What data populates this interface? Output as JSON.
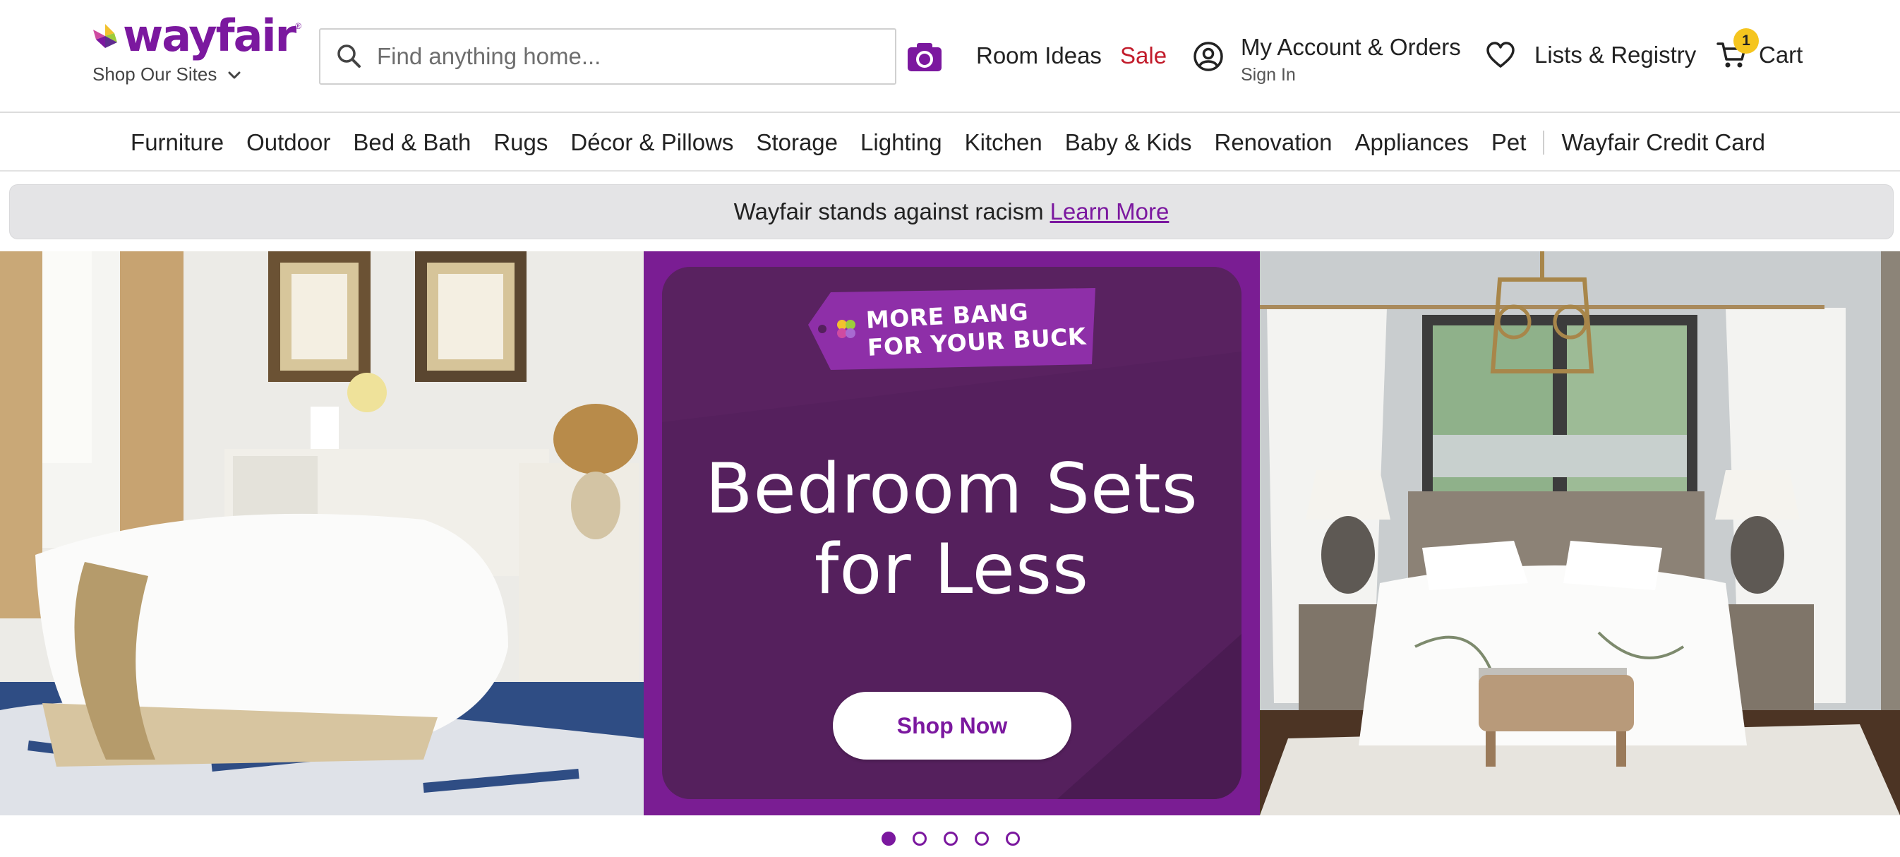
{
  "header": {
    "logo_text": "wayfair",
    "shop_sites_label": "Shop Our Sites",
    "search_placeholder": "Find anything home...",
    "room_ideas": "Room Ideas",
    "sale": "Sale",
    "account_label": "My Account & Orders",
    "sign_in": "Sign In",
    "lists_label": "Lists & Registry",
    "cart_label": "Cart",
    "cart_count": "1",
    "brand_color": "#7b189f",
    "sale_color": "#c21c2b",
    "badge_color": "#f5c51f"
  },
  "categories": [
    "Furniture",
    "Outdoor",
    "Bed & Bath",
    "Rugs",
    "Décor & Pillows",
    "Storage",
    "Lighting",
    "Kitchen",
    "Baby & Kids",
    "Renovation",
    "Appliances",
    "Pet"
  ],
  "credit_card_link": "Wayfair Credit Card",
  "notice": {
    "text": "Wayfair stands against racism",
    "link": "Learn More"
  },
  "hero": {
    "tag_line1": "MORE BANG",
    "tag_line2": "FOR YOUR BUCK",
    "headline_line1": "Bedroom Sets",
    "headline_line2": "for Less",
    "cta": "Shop Now",
    "panel_color": "#7a1d93"
  },
  "carousel": {
    "slides": 5,
    "active_index": 0
  }
}
